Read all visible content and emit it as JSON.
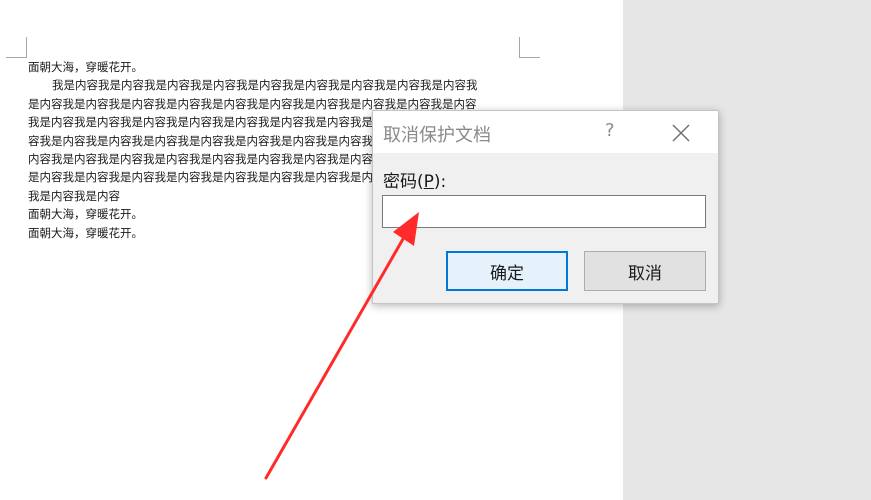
{
  "document": {
    "lines": [
      "面朝大海，穿暖花开。",
      "我是内容我是内容我是内容我是内容我是内容我是内容我是内容我是内容我是内容我",
      "是内容我是内容我是内容我是内容我是内容我是内容我是内容我是内容我是内容我是内容",
      "我是内容我是内容我是内容我是内容我是内容我是内容我是内容我是内容我是内容我是内",
      "容我是内容我是内容我是内容我是内容我是内容我是内容我是内容我是内容我是内容我是",
      "内容我是内容我是内容我是内容我是内容我是内容我是内容我是内容我是内容我是内容我",
      "是内容我是内容我是内容我是内容我是内容我是内容我是内容我是内容我是内容我是内容",
      "我是内容我是内容",
      "面朝大海，穿暖花开。",
      "面朝大海，穿暖花开。"
    ]
  },
  "dialog": {
    "title": "取消保护文档",
    "help": "?",
    "password_label": "密码(",
    "password_accel": "P",
    "password_label_end": "):",
    "password_value": "",
    "ok_label": "确定",
    "cancel_label": "取消"
  },
  "colors": {
    "annotation_arrow": "#ff2a2a",
    "default_button_border": "#0078d7",
    "side_area": "#e6e6e6"
  }
}
